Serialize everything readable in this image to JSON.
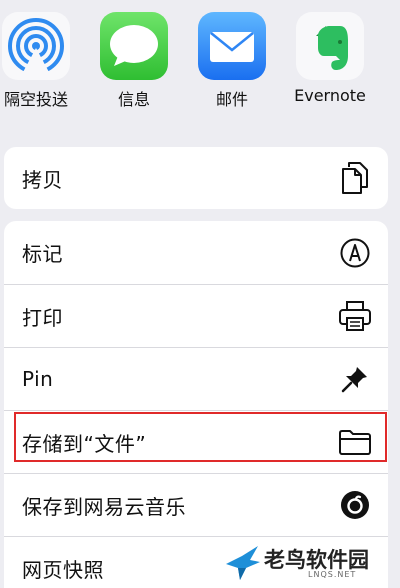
{
  "share_apps": [
    {
      "label": "隔空投送",
      "icon": "airdrop-icon"
    },
    {
      "label": "信息",
      "icon": "messages-icon"
    },
    {
      "label": "邮件",
      "icon": "mail-icon"
    },
    {
      "label": "Evernote",
      "icon": "evernote-icon"
    }
  ],
  "copy_group": {
    "copy_label": "拷贝"
  },
  "actions": {
    "markup_label": "标记",
    "print_label": "打印",
    "pin_label": "Pin",
    "save_to_files_label": "存储到“文件”",
    "netease_label": "保存到网易云音乐",
    "web_snapshot_label": "网页快照"
  },
  "watermark": {
    "title": "老鸟软件园",
    "subtitle": "LNQS.NET"
  },
  "colors": {
    "highlight": "#e02a2a",
    "background": "#ededf2"
  }
}
